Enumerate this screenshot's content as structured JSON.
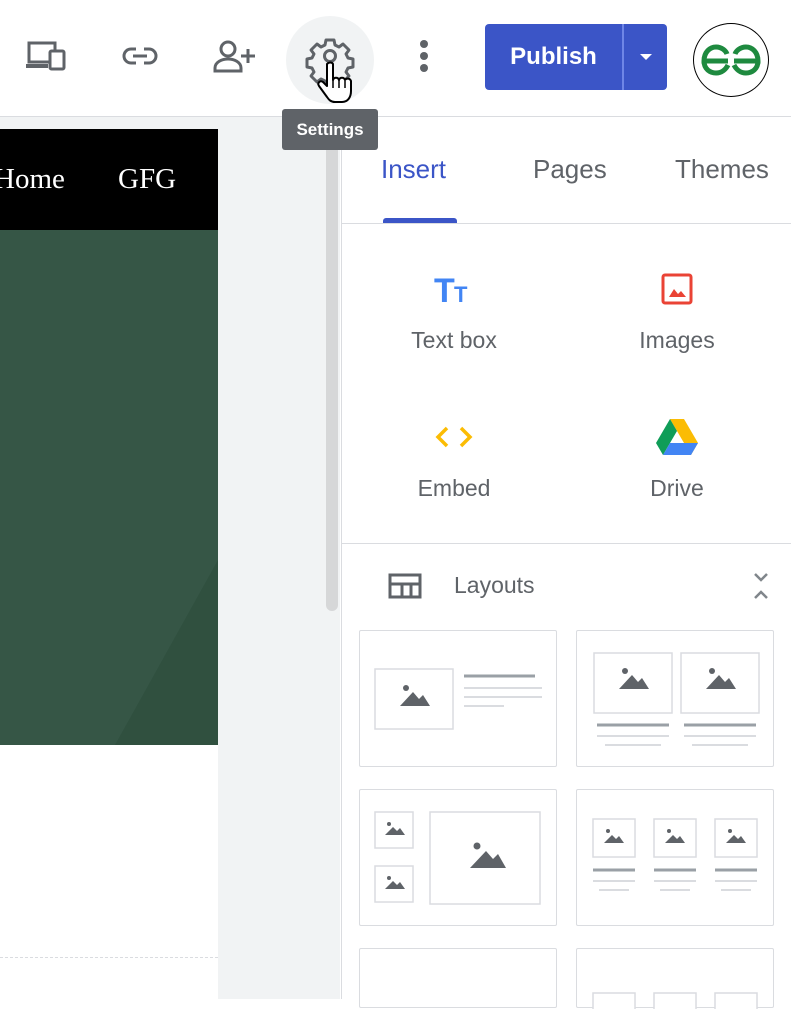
{
  "toolbar": {
    "icons": [
      "preview-devices-icon",
      "link-icon",
      "add-person-icon",
      "gear-icon",
      "more-vert-icon"
    ],
    "tooltip": "Settings",
    "publish_label": "Publish",
    "logo_text": "ƏG",
    "accent": "#3b55c7"
  },
  "preview": {
    "nav_links": [
      "Home",
      "GFG"
    ],
    "hero_color": "#365646"
  },
  "panel": {
    "tabs": [
      {
        "label": "Insert",
        "active": true
      },
      {
        "label": "Pages",
        "active": false
      },
      {
        "label": "Themes",
        "active": false
      }
    ],
    "insert_items": [
      {
        "label": "Text box",
        "icon": "text-box-icon"
      },
      {
        "label": "Images",
        "icon": "image-icon"
      },
      {
        "label": "Embed",
        "icon": "embed-icon"
      },
      {
        "label": "Drive",
        "icon": "drive-icon"
      }
    ],
    "layouts_label": "Layouts",
    "icon_tt": "Tт"
  }
}
